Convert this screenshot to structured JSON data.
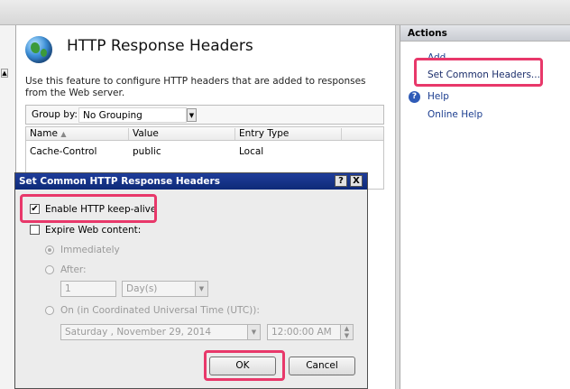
{
  "feature": {
    "title": "HTTP Response Headers",
    "description": "Use this feature to configure HTTP headers that are added to responses from the Web server.",
    "group_by_label": "Group by:",
    "group_by_value": "No Grouping",
    "columns": [
      "Name",
      "Value",
      "Entry Type"
    ],
    "rows": [
      [
        "Cache-Control",
        "public",
        "Local"
      ]
    ]
  },
  "actions": {
    "header": "Actions",
    "add": "Add...",
    "set_common": "Set Common Headers...",
    "help": "Help",
    "online_help": "Online Help"
  },
  "dialog": {
    "title": "Set Common HTTP Response Headers",
    "help_btn": "?",
    "close_btn": "X",
    "keepalive_label": "Enable HTTP keep-alive",
    "keepalive_checked": "✔",
    "expire_label": "Expire Web content:",
    "immediately_label": "Immediately",
    "after_label": "After:",
    "after_value": "1",
    "after_unit": "Day(s)",
    "on_label": "On (in Coordinated Universal Time (UTC)):",
    "date_value": "Saturday  , November 29, 2014",
    "time_value": "12:00:00 AM",
    "ok": "OK",
    "cancel": "Cancel"
  },
  "colors": {
    "highlight": "#e8386a",
    "titlebar": "#1f3d9a",
    "link": "#1b3d8f"
  }
}
